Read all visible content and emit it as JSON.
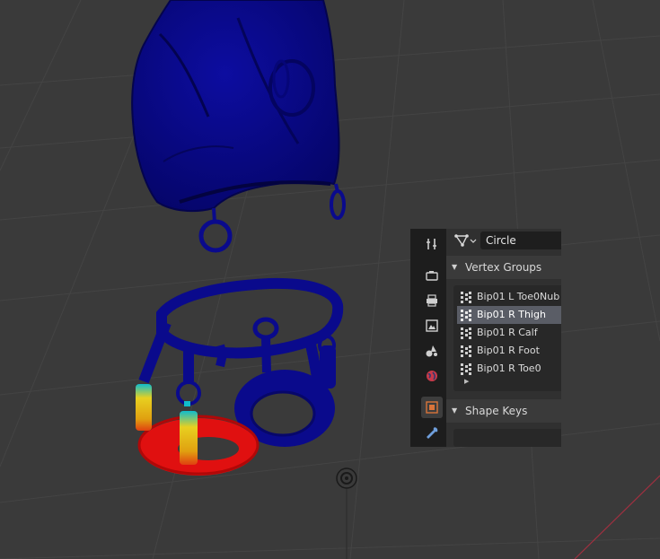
{
  "object_name": "Circle",
  "vertex_groups": {
    "title": "Vertex Groups",
    "items": [
      {
        "label": "Bip01 L Toe0Nub",
        "selected": false
      },
      {
        "label": "Bip01 R Thigh",
        "selected": true
      },
      {
        "label": "Bip01 R Calf",
        "selected": false
      },
      {
        "label": "Bip01 R Foot",
        "selected": false
      },
      {
        "label": "Bip01 R Toe0",
        "selected": false
      }
    ]
  },
  "shape_keys": {
    "title": "Shape Keys"
  },
  "property_tabs": [
    "tool",
    "render",
    "output",
    "view-layer",
    "scene",
    "world",
    "object",
    "modifiers"
  ],
  "colors": {
    "viewport_bg": "#3a3a3a",
    "grid_line": "#444444",
    "mesh_blue": "#0a0a8c",
    "weight_red": "#e01010",
    "weight_yellow": "#e8d020",
    "axis_red": "#a03040",
    "panel_bg": "#303030",
    "header_bg": "#3a3a3a",
    "list_bg": "#282828",
    "selection": "#5a5d66"
  }
}
